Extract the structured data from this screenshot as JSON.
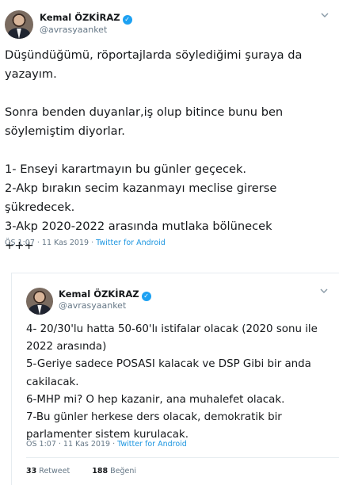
{
  "tweets": [
    {
      "name": "Kemal ÖZKİRAZ",
      "handle": "@avrasyaanket",
      "text": "Düşündüğümü, röportajlarda söylediğimi şuraya da\nyazayım.\n\nSonra benden duyanlar,iş olup bitince bunu ben\nsöylemiştim diyorlar.\n\n1- Enseyi karartmayın bu günler geçecek.\n2-Akp bırakın secim kazanmayı meclise girerse\nşükredecek.\n3-Akp 2020-2022 arasında mutlaka bölünecek\n+++",
      "time": "ÖS 1:07 · 11 Kas 2019 · ",
      "client": "Twitter for Android"
    },
    {
      "name": "Kemal ÖZKİRAZ",
      "handle": "@avrasyaanket",
      "text": "4- 20/30'lu hatta 50-60'lı istifalar olacak (2020 sonu ile\n2022 arasında)\n5-Geriye sadece POSASI kalacak ve DSP Gibi bir anda\ncakilacak.\n6-MHP mi? O hep kazanir, ana muhalefet olacak.\n7-Bu günler herkese ders olacak, demokratik bir\nparlamenter sistem kurulacak.",
      "time": "ÖS 1:07 · 11 Kas 2019 · ",
      "client": "Twitter for Android",
      "retweet_count": "33",
      "retweet_label": "Retweet",
      "like_count": "188",
      "like_label": "Beğeni"
    }
  ],
  "icons": {
    "verified": "verified-badge-icon",
    "chevron": "chevron-down-icon"
  },
  "colors": {
    "link": "#1b95e0",
    "secondary_text": "#657786",
    "verified": "#1da1f2"
  }
}
